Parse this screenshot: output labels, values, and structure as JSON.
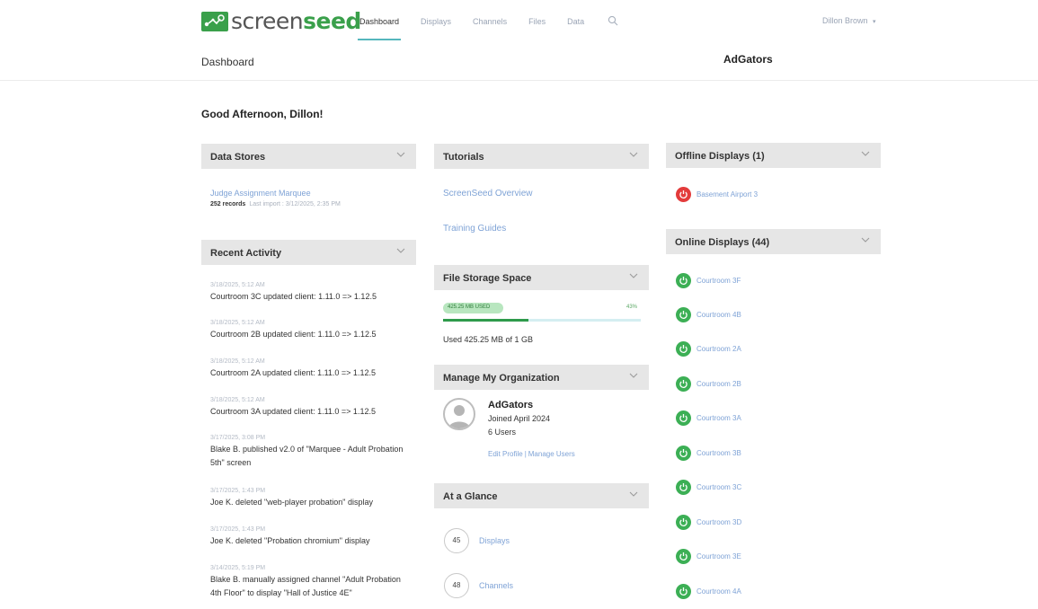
{
  "app": {
    "logo_text_a": "screen",
    "logo_text_b": "seed",
    "nav": [
      "Dashboard",
      "Displays",
      "Channels",
      "Files",
      "Data"
    ],
    "user": "Dillon Brown",
    "breadcrumb": "Dashboard",
    "org_name": "AdGators",
    "greeting": "Good Afternoon, Dillon!"
  },
  "data_stores": {
    "title": "Data Stores",
    "item_link": "Judge Assignment Marquee",
    "records": "252 records",
    "last_import": "Last import : 3/12/2025, 2:35 PM"
  },
  "recent_activity": {
    "title": "Recent Activity",
    "items": [
      {
        "time": "3/18/2025, 5:12 AM",
        "text": "Courtroom 3C updated client: 1.11.0 => 1.12.5"
      },
      {
        "time": "3/18/2025, 5:12 AM",
        "text": "Courtroom 2B updated client: 1.11.0 => 1.12.5"
      },
      {
        "time": "3/18/2025, 5:12 AM",
        "text": "Courtroom 2A updated client: 1.11.0 => 1.12.5"
      },
      {
        "time": "3/18/2025, 5:12 AM",
        "text": "Courtroom 3A updated client: 1.11.0 => 1.12.5"
      },
      {
        "time": "3/17/2025, 3:08 PM",
        "text": "Blake B. published v2.0 of \"Marquee - Adult Probation 5th\" screen"
      },
      {
        "time": "3/17/2025, 1:43 PM",
        "text": "Joe K. deleted \"web-player probation\" display"
      },
      {
        "time": "3/17/2025, 1:43 PM",
        "text": "Joe K. deleted \"Probation chromium\" display"
      },
      {
        "time": "3/14/2025, 5:19 PM",
        "text": "Blake B. manually assigned channel \"Adult Probation 4th Floor\" to display \"Hall of Justice 4E\""
      }
    ]
  },
  "tutorials": {
    "title": "Tutorials",
    "links": [
      "ScreenSeed Overview",
      "Training Guides"
    ]
  },
  "file_storage": {
    "title": "File Storage Space",
    "badge": "425.25 MB USED",
    "percent_label": "43%",
    "percent_value": 0.43,
    "used_text": "Used 425.25 MB of 1 GB"
  },
  "organization": {
    "title": "Manage My Organization",
    "name": "AdGators",
    "joined": "Joined April 2024",
    "users": "6 Users",
    "edit_profile": "Edit Profile",
    "separator": "|",
    "manage_users": "Manage Users"
  },
  "glance": {
    "title": "At a Glance",
    "items": [
      {
        "count": "45",
        "label": "Displays"
      },
      {
        "count": "48",
        "label": "Channels"
      }
    ]
  },
  "offline_displays": {
    "title": "Offline Displays (1)",
    "items": [
      "Basement Airport 3"
    ]
  },
  "online_displays": {
    "title": "Online Displays (44)",
    "items": [
      "Courtroom 3F",
      "Courtroom 4B",
      "Courtroom 2A",
      "Courtroom 2B",
      "Courtroom 3A",
      "Courtroom 3B",
      "Courtroom 3C",
      "Courtroom 3D",
      "Courtroom 3E",
      "Courtroom 4A"
    ]
  },
  "colors": {
    "brand_green": "#3aa04b",
    "link_blue": "#7fa3d6",
    "nav_underline": "#55b7bd",
    "offline_red": "#e33b3b",
    "online_green": "#3caf55",
    "panel_header": "#e6e6e6"
  }
}
